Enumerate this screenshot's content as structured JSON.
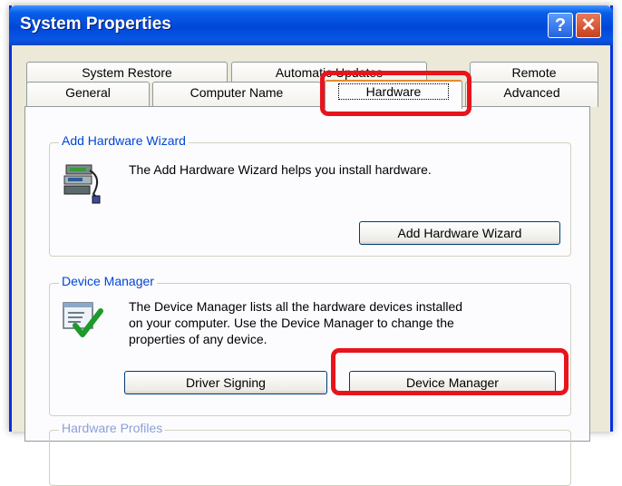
{
  "window": {
    "title": "System Properties",
    "help_glyph": "?",
    "close_glyph": "✕"
  },
  "tabs": {
    "back_row": [
      {
        "label": "System Restore"
      },
      {
        "label": "Automatic Updates"
      },
      {
        "label": "Remote"
      }
    ],
    "front_row": [
      {
        "label": "General"
      },
      {
        "label": "Computer Name"
      },
      {
        "label": "Hardware",
        "selected": true
      },
      {
        "label": "Advanced"
      }
    ]
  },
  "add_hardware": {
    "legend": "Add Hardware Wizard",
    "description": "The Add Hardware Wizard helps you install hardware.",
    "button_label": "Add Hardware Wizard",
    "icon": "hardware-wizard-icon"
  },
  "device_manager": {
    "legend": "Device Manager",
    "description_lines": [
      "The Device Manager lists all the hardware devices installed",
      "on your computer. Use the Device Manager to change the",
      "properties of any device."
    ],
    "driver_signing_label": "Driver Signing",
    "button_label": "Device Manager",
    "icon": "device-manager-icon"
  },
  "hardware_profiles": {
    "legend": "Hardware Profiles"
  },
  "colors": {
    "title_blue": "#0047d8",
    "highlight_red": "#e8141c",
    "legend_blue": "#0046d5",
    "tab_orange": "#e68b2c"
  }
}
